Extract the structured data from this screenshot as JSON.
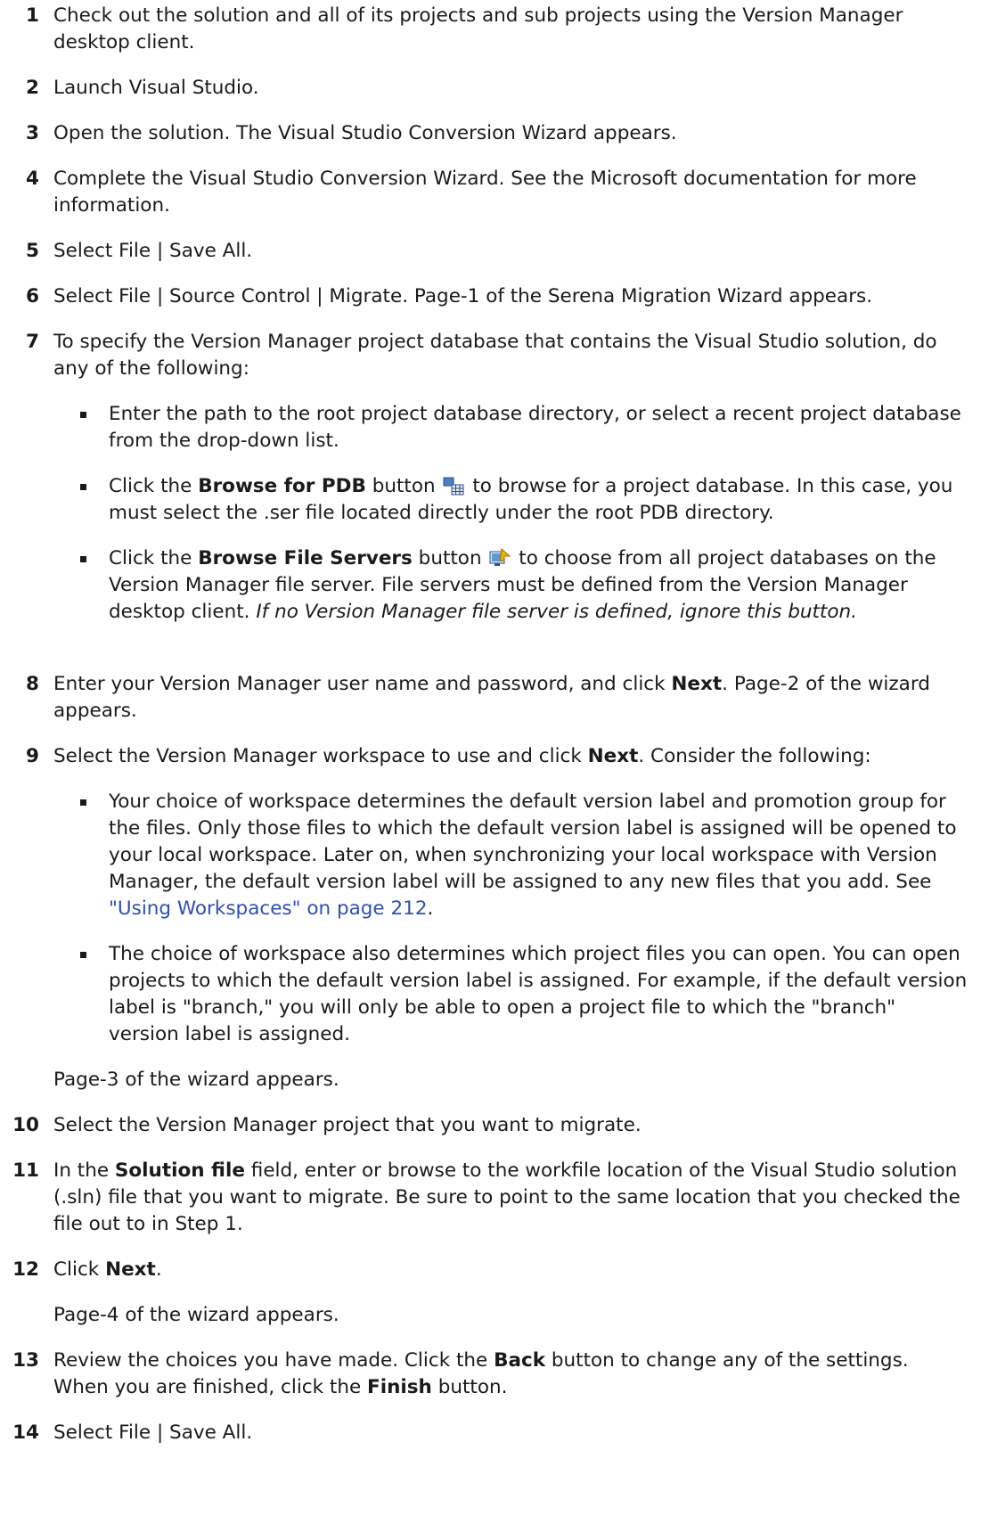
{
  "steps": [
    {
      "num": "1",
      "text": "Check out the solution and all of its projects and sub projects using the Version Manager desktop client."
    },
    {
      "num": "2",
      "text": "Launch Visual Studio."
    },
    {
      "num": "3",
      "text": "Open the solution. The Visual Studio Conversion Wizard appears."
    },
    {
      "num": "4",
      "text": "Complete the Visual Studio Conversion Wizard. See the Microsoft documentation for more information."
    },
    {
      "num": "5",
      "text": "Select File | Save All."
    },
    {
      "num": "6",
      "text": "Select File | Source Control | Migrate. Page-1 of the Serena Migration Wizard appears."
    },
    {
      "num": "7",
      "text": "To specify the Version Manager project database that contains the Visual Studio solution, do any of the following:"
    },
    {
      "num": "8",
      "a": "Enter your Version Manager user name and password, and click ",
      "b": "Next",
      "c": ". Page-2 of the wizard appears."
    },
    {
      "num": "9",
      "a": "Select the Version Manager workspace to use and click ",
      "b": "Next",
      "c": ". Consider the following:"
    },
    {
      "num": "10",
      "text": "Select the Version Manager project that you want to migrate."
    },
    {
      "num": "11",
      "a": "In the ",
      "b": "Solution file",
      "c": " field, enter or browse to the workfile location of the Visual Studio solution (.sln) file that you want to migrate. Be sure to point to the same location that you checked the file out to in Step 1."
    },
    {
      "num": "12",
      "a": "Click ",
      "b": "Next",
      "c": "."
    },
    {
      "num": "13",
      "a": "Review the choices you have made. Click the ",
      "b": "Back",
      "c": " button to change any of the settings. When you are finished, click the ",
      "d": "Finish",
      "e": " button."
    },
    {
      "num": "14",
      "text": "Select File | Save All."
    }
  ],
  "step7_bullets": {
    "b1": "Enter the path to the root project database directory, or select a recent project database from the drop-down list.",
    "b2": {
      "a": "Click the ",
      "b": "Browse for PDB",
      "c": " button",
      "d": " to browse for a project database. In this case, you must select the .ser file located directly under the root PDB directory."
    },
    "b3": {
      "a": "Click the ",
      "b": "Browse File Servers",
      "c": " button",
      "d": " to choose from all project databases on the Version Manager file server. File servers must be defined from the Version Manager desktop client. ",
      "e": "If no Version Manager file server is defined, ignore this button."
    }
  },
  "step9_bullets": {
    "b1": {
      "a": "Your choice of workspace determines the default version label and promotion group for the files. Only those files to which the default version label is assigned will be opened to your local workspace. Later on, when synchronizing your local workspace with Version Manager, the default version label will be assigned to any new files that you add. See ",
      "link": "\"Using Workspaces\" on page 212",
      "c": "."
    },
    "b2": "The choice of workspace also determines which project files you can open. You can open projects to which the default version label is assigned. For example, if the default version label is \"branch,\" you will only be able to open a project file to which the \"branch\" version label is assigned."
  },
  "para_page3": "Page-3 of the wizard appears.",
  "para_page4": "Page-4 of the wizard appears.",
  "icons": [
    "browse-pdb-icon",
    "browse-file-servers-icon"
  ],
  "colors": {
    "text": "#1a1a1a",
    "link": "#2f4fb3"
  }
}
